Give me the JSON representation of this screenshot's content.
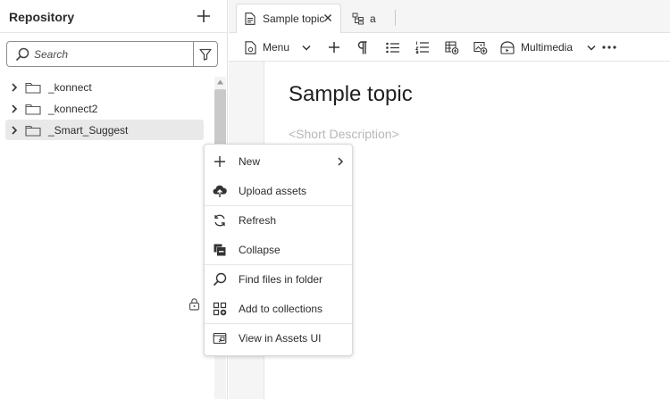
{
  "repository": {
    "title": "Repository",
    "search_placeholder": "Search",
    "tree_items": [
      {
        "label": "_konnect",
        "selected": false
      },
      {
        "label": "_konnect2",
        "selected": false
      },
      {
        "label": "_Smart_Suggest",
        "selected": true
      }
    ]
  },
  "tabs": [
    {
      "label": "Sample topic",
      "active": true,
      "icon": "document-icon"
    },
    {
      "label": "a",
      "active": false,
      "icon": "map-icon"
    }
  ],
  "toolbar": {
    "menu_label": "Menu",
    "multimedia_label": "Multimedia"
  },
  "document": {
    "title": "Sample topic",
    "short_description_placeholder": "<Short Description>"
  },
  "context_menu": {
    "items": [
      {
        "label": "New",
        "icon": "plus-icon",
        "submenu": true
      },
      {
        "label": "Upload assets",
        "icon": "cloud-upload-icon"
      },
      {
        "label": "Refresh",
        "icon": "refresh-icon"
      },
      {
        "label": "Collapse",
        "icon": "collapse-icon"
      },
      {
        "label": "Find files in folder",
        "icon": "search-icon"
      },
      {
        "label": "Add to collections",
        "icon": "add-collection-icon"
      },
      {
        "label": "View in Assets UI",
        "icon": "view-assets-icon"
      }
    ]
  }
}
